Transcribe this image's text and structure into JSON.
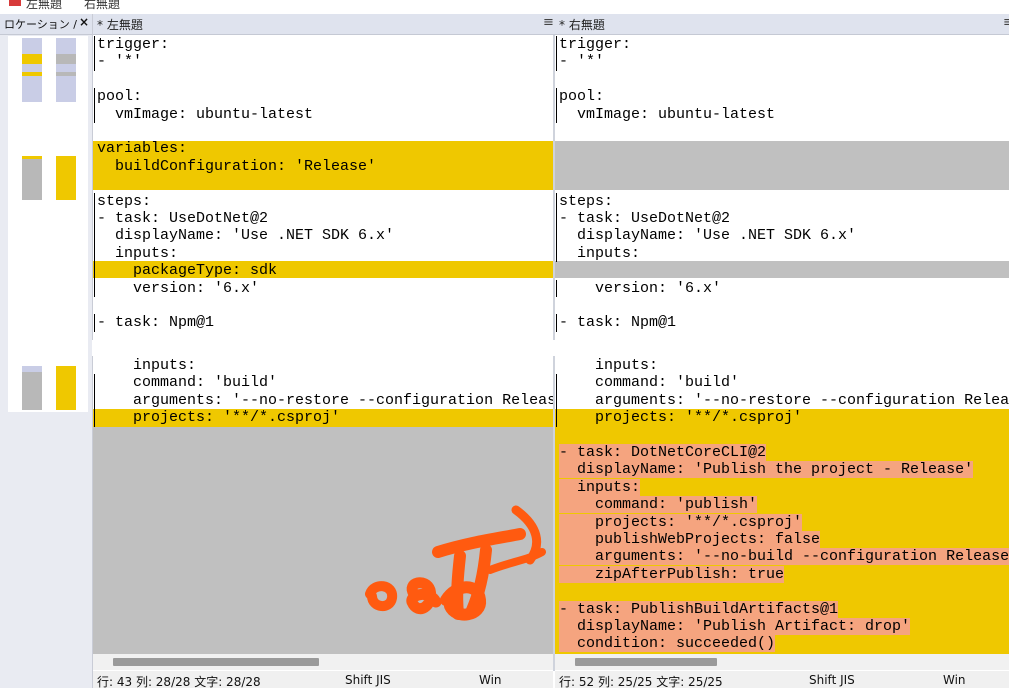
{
  "top_tabs": [
    "左無題",
    "右無題"
  ],
  "left_panel": {
    "title": "ロケーション /",
    "close": "×"
  },
  "panes": {
    "left": {
      "title": "* 左無題",
      "menu": "≡"
    },
    "right": {
      "title": "* 右無題",
      "menu": "≡"
    }
  },
  "code_top": [
    "trigger:",
    "- '*'",
    "",
    "pool:",
    "  vmImage: ubuntu-latest",
    "",
    "variables:",
    "  buildConfiguration: 'Release'",
    "",
    "steps:",
    "- task: UseDotNet@2",
    "  displayName: 'Use .NET SDK 6.x'",
    "  inputs:",
    "    packageType: sdk",
    "    version: '6.x'",
    "",
    "- task: Npm@1"
  ],
  "code_mid": [
    "    inputs:",
    "    command: 'build'",
    "    arguments: '--no-restore --configuration Release'",
    "    projects: '**/*.csproj'"
  ],
  "code_right_extra": [
    "",
    "- task: DotNetCoreCLI@2",
    "  displayName: 'Publish the project - Release'",
    "  inputs:",
    "    command: 'publish'",
    "    projects: '**/*.csproj'",
    "    publishWebProjects: false",
    "    arguments: '--no-build --configuration Release --'",
    "    zipAfterPublish: true",
    "",
    "- task: PublishBuildArtifacts@1",
    "  displayName: 'Publish Artifact: drop'",
    "  condition: succeeded()"
  ],
  "status_left": {
    "pos": "行: 43  列: 28/28  文字: 28/28",
    "encoding": "Shift JIS",
    "eol": "Win"
  },
  "status_right": {
    "pos": "行: 52  列: 25/25  文字: 25/25",
    "encoding": "Shift JIS",
    "eol": "Win"
  },
  "colors": {
    "diff_yellow": "#efc800",
    "diff_gray": "#c0c0c0",
    "highlight": "#f5a47f",
    "annotation_orange": "#ff5a10"
  }
}
